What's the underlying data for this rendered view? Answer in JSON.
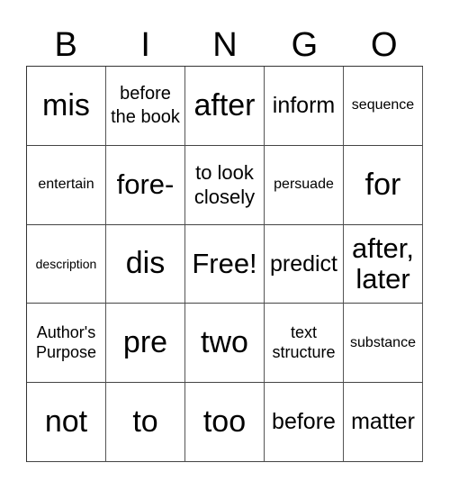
{
  "header": [
    "B",
    "I",
    "N",
    "G",
    "O"
  ],
  "cells": [
    [
      "mis",
      "before the book",
      "after",
      "inform",
      "sequence"
    ],
    [
      "entertain",
      "fore-",
      "to look closely",
      "persuade",
      "for"
    ],
    [
      "description",
      "dis",
      "Free!",
      "predict",
      "after, later"
    ],
    [
      "Author's Purpose",
      "pre",
      "two",
      "text structure",
      "substance"
    ],
    [
      "not",
      "to",
      "too",
      "before",
      "matter"
    ]
  ]
}
